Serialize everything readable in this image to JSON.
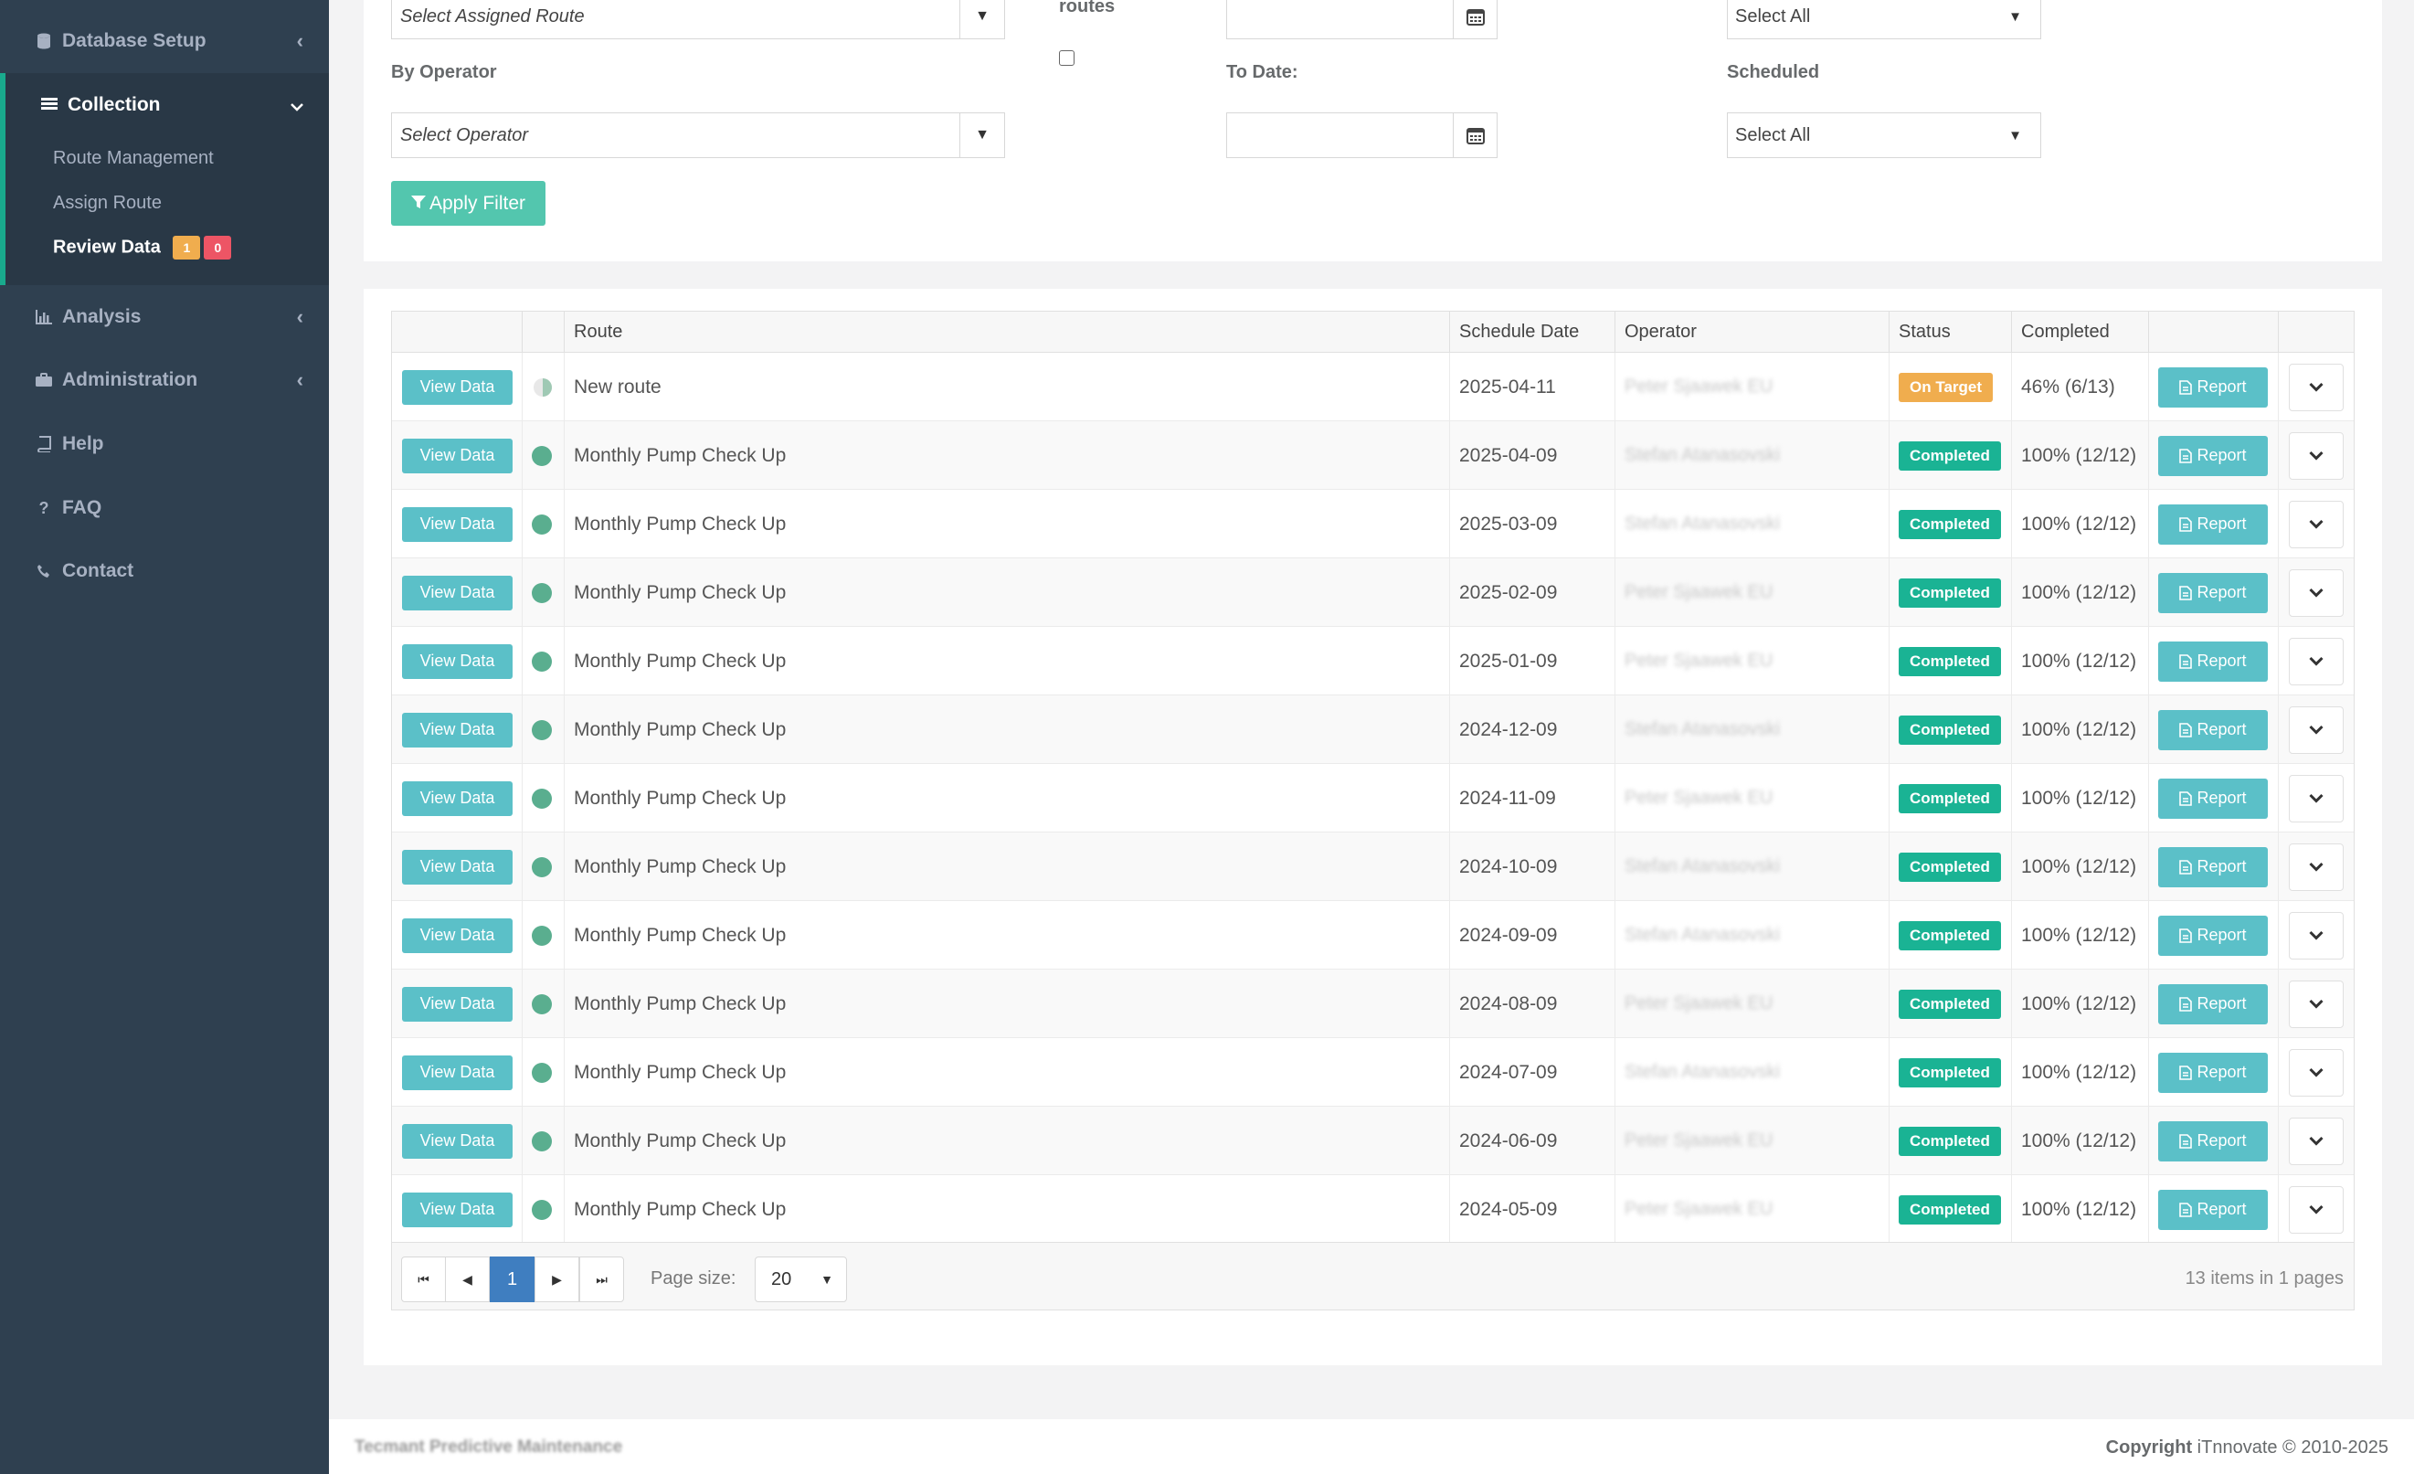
{
  "sidebar": {
    "items": [
      {
        "label": "Database Setup",
        "icon": "database-icon"
      },
      {
        "label": "Collection",
        "icon": "table-icon"
      },
      {
        "label": "Analysis",
        "icon": "bar-chart-icon"
      },
      {
        "label": "Administration",
        "icon": "briefcase-icon"
      },
      {
        "label": "Help",
        "icon": "book-icon"
      },
      {
        "label": "FAQ",
        "icon": "question-icon"
      },
      {
        "label": "Contact",
        "icon": "phone-icon"
      }
    ],
    "collection_sub": [
      {
        "label": "Route Management"
      },
      {
        "label": "Assign Route"
      },
      {
        "label": "Review Data",
        "badge_warn": "1",
        "badge_danger": "0"
      }
    ]
  },
  "filters": {
    "assigned_route_placeholder": "Select Assigned Route",
    "routes_label": "routes",
    "operator_label": "By Operator",
    "operator_placeholder": "Select Operator",
    "to_date_label": "To Date:",
    "scheduled_label": "Scheduled",
    "select_all_1": "Select All",
    "select_all_2": "Select All",
    "apply_label": "Apply Filter"
  },
  "table": {
    "columns": [
      "Route",
      "Schedule Date",
      "Operator",
      "Status",
      "Completed"
    ],
    "view_label": "View Data",
    "report_label": "Report",
    "rows": [
      {
        "route": "New route",
        "date": "2025-04-11",
        "operator": "Peter Sjaawek EU",
        "status": "On Target",
        "status_color": "#f0ad4e",
        "completed": "46% (6/13)",
        "partial": true
      },
      {
        "route": "Monthly Pump Check Up",
        "date": "2025-04-09",
        "operator": "Stefan Atanasovski",
        "status": "Completed",
        "status_color": "#1ab394",
        "completed": "100% (12/12)"
      },
      {
        "route": "Monthly Pump Check Up",
        "date": "2025-03-09",
        "operator": "Stefan Atanasovski",
        "status": "Completed",
        "status_color": "#1ab394",
        "completed": "100% (12/12)"
      },
      {
        "route": "Monthly Pump Check Up",
        "date": "2025-02-09",
        "operator": "Peter Sjaawek EU",
        "status": "Completed",
        "status_color": "#1ab394",
        "completed": "100% (12/12)"
      },
      {
        "route": "Monthly Pump Check Up",
        "date": "2025-01-09",
        "operator": "Peter Sjaawek EU",
        "status": "Completed",
        "status_color": "#1ab394",
        "completed": "100% (12/12)"
      },
      {
        "route": "Monthly Pump Check Up",
        "date": "2024-12-09",
        "operator": "Stefan Atanasovski",
        "status": "Completed",
        "status_color": "#1ab394",
        "completed": "100% (12/12)"
      },
      {
        "route": "Monthly Pump Check Up",
        "date": "2024-11-09",
        "operator": "Peter Sjaawek EU",
        "status": "Completed",
        "status_color": "#1ab394",
        "completed": "100% (12/12)"
      },
      {
        "route": "Monthly Pump Check Up",
        "date": "2024-10-09",
        "operator": "Stefan Atanasovski",
        "status": "Completed",
        "status_color": "#1ab394",
        "completed": "100% (12/12)"
      },
      {
        "route": "Monthly Pump Check Up",
        "date": "2024-09-09",
        "operator": "Stefan Atanasovski",
        "status": "Completed",
        "status_color": "#1ab394",
        "completed": "100% (12/12)"
      },
      {
        "route": "Monthly Pump Check Up",
        "date": "2024-08-09",
        "operator": "Peter Sjaawek EU",
        "status": "Completed",
        "status_color": "#1ab394",
        "completed": "100% (12/12)"
      },
      {
        "route": "Monthly Pump Check Up",
        "date": "2024-07-09",
        "operator": "Stefan Atanasovski",
        "status": "Completed",
        "status_color": "#1ab394",
        "completed": "100% (12/12)"
      },
      {
        "route": "Monthly Pump Check Up",
        "date": "2024-06-09",
        "operator": "Peter Sjaawek EU",
        "status": "Completed",
        "status_color": "#1ab394",
        "completed": "100% (12/12)"
      },
      {
        "route": "Monthly Pump Check Up",
        "date": "2024-05-09",
        "operator": "Peter Sjaawek EU",
        "status": "Completed",
        "status_color": "#1ab394",
        "completed": "100% (12/12)"
      }
    ]
  },
  "pager": {
    "current_page": "1",
    "page_size_label": "Page size:",
    "page_size": "20",
    "summary": "13 items in 1 pages"
  },
  "footer": {
    "company": "Tecmant Predictive Maintenance",
    "copyright_label": "Copyright",
    "copyright_text": "iTnnovate © 2010-2025"
  }
}
